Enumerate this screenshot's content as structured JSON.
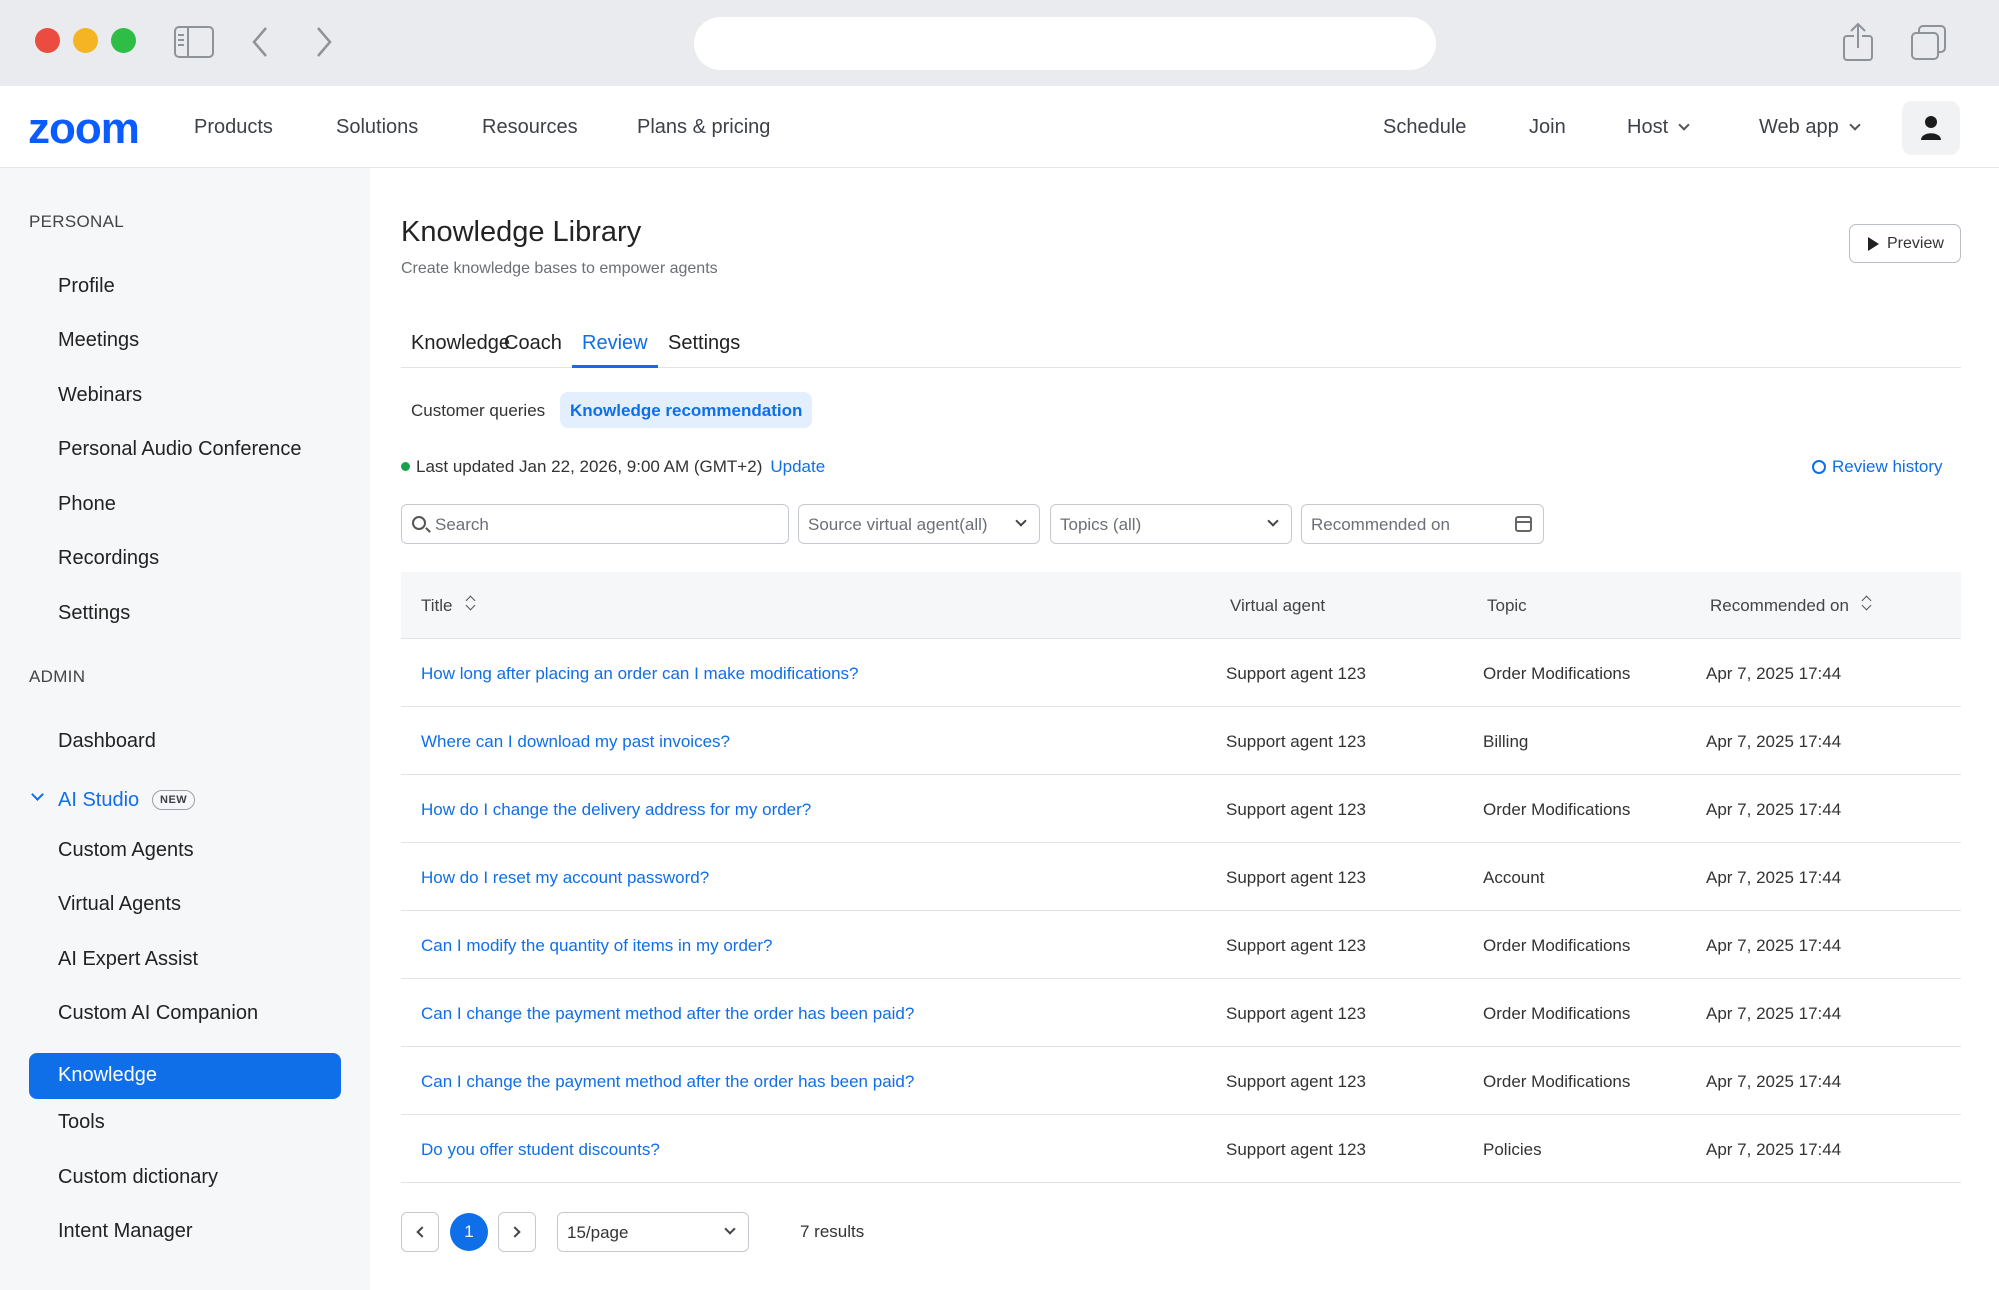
{
  "nav": {
    "logo": "zoom",
    "links": [
      "Products",
      "Solutions",
      "Resources",
      "Plans & pricing"
    ],
    "right": [
      "Schedule",
      "Join",
      "Host",
      "Web app"
    ]
  },
  "sidebar": {
    "personal_header": "PERSONAL",
    "personal_items": [
      "Profile",
      "Meetings",
      "Webinars",
      "Personal Audio Conference",
      "Phone",
      "Recordings",
      "Settings"
    ],
    "admin_header": "ADMIN",
    "dashboard": "Dashboard",
    "ai_studio": {
      "label": "AI Studio",
      "badge": "NEW"
    },
    "ai_items": [
      "Custom Agents",
      "Virtual Agents",
      "AI Expert Assist",
      "Custom AI Companion",
      "Knowledge",
      "Tools",
      "Custom dictionary",
      "Intent Manager"
    ],
    "active_item": "Knowledge"
  },
  "page": {
    "title": "Knowledge Library",
    "subtitle": "Create knowledge bases to empower agents",
    "preview_label": "Preview",
    "tabs": [
      "Knowledge",
      "Coach",
      "Review",
      "Settings"
    ],
    "active_tab": "Review",
    "segments": [
      "Customer queries",
      "Knowledge recommendation"
    ],
    "active_segment": "Knowledge recommendation",
    "last_updated": "Last updated Jan 22, 2026, 9:00 AM (GMT+2)",
    "update_link": "Update",
    "review_history": "Review history"
  },
  "filters": {
    "search_placeholder": "Search",
    "source_agent": "Source virtual agent(all)",
    "topics": "Topics (all)",
    "recommended_on": "Recommended on"
  },
  "table": {
    "columns": [
      "Title",
      "Virtual agent",
      "Topic",
      "Recommended on"
    ],
    "rows": [
      {
        "title": "How long after placing an order can I make modifications?",
        "agent": "Support agent 123",
        "topic": "Order Modifications",
        "date": "Apr 7, 2025 17:44"
      },
      {
        "title": "Where can I download my past invoices?",
        "agent": "Support agent 123",
        "topic": "Billing",
        "date": "Apr 7, 2025 17:44"
      },
      {
        "title": "How do I change the delivery address for my order?",
        "agent": "Support agent 123",
        "topic": "Order Modifications",
        "date": "Apr 7, 2025 17:44"
      },
      {
        "title": "How do I reset my account password?",
        "agent": "Support agent 123",
        "topic": "Account",
        "date": "Apr 7, 2025 17:44"
      },
      {
        "title": "Can I modify the quantity of items in my order?",
        "agent": "Support agent 123",
        "topic": "Order Modifications",
        "date": "Apr 7, 2025 17:44"
      },
      {
        "title": "Can I change the payment method after the order has been paid?",
        "agent": "Support agent 123",
        "topic": "Order Modifications",
        "date": "Apr 7, 2025 17:44"
      },
      {
        "title": "Can I change the payment method after the order has been paid?",
        "agent": "Support agent 123",
        "topic": "Order Modifications",
        "date": "Apr 7, 2025 17:44"
      },
      {
        "title": "Do you offer student discounts?",
        "agent": "Support agent 123",
        "topic": "Policies",
        "date": "Apr 7, 2025 17:44"
      }
    ]
  },
  "pagination": {
    "current_page": "1",
    "per_page": "15/page",
    "results": "7 results"
  },
  "colors": {
    "accent": "#0e6fe8",
    "brand": "#0b5cff"
  }
}
